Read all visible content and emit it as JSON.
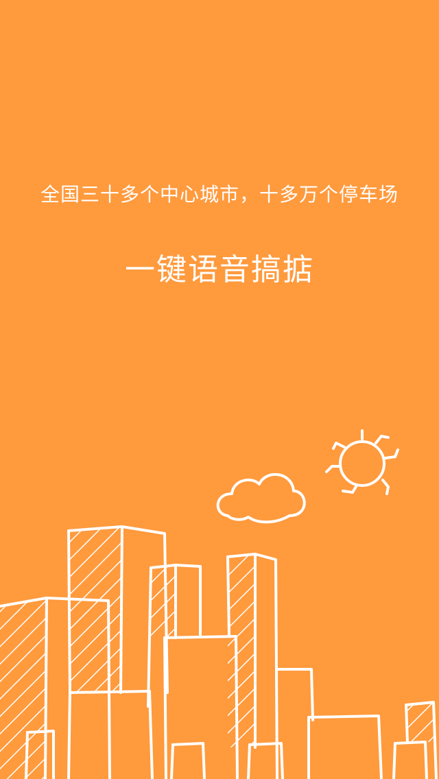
{
  "splash": {
    "subtitle": "全国三十多个中心城市，十多万个停车场",
    "headline": "一键语音搞掂"
  },
  "colors": {
    "background": "#FF9A3D",
    "foreground": "#FFFFFF"
  },
  "illustration": {
    "icons": [
      "sun-icon",
      "cloud-icon",
      "city-skyline-icon"
    ]
  }
}
